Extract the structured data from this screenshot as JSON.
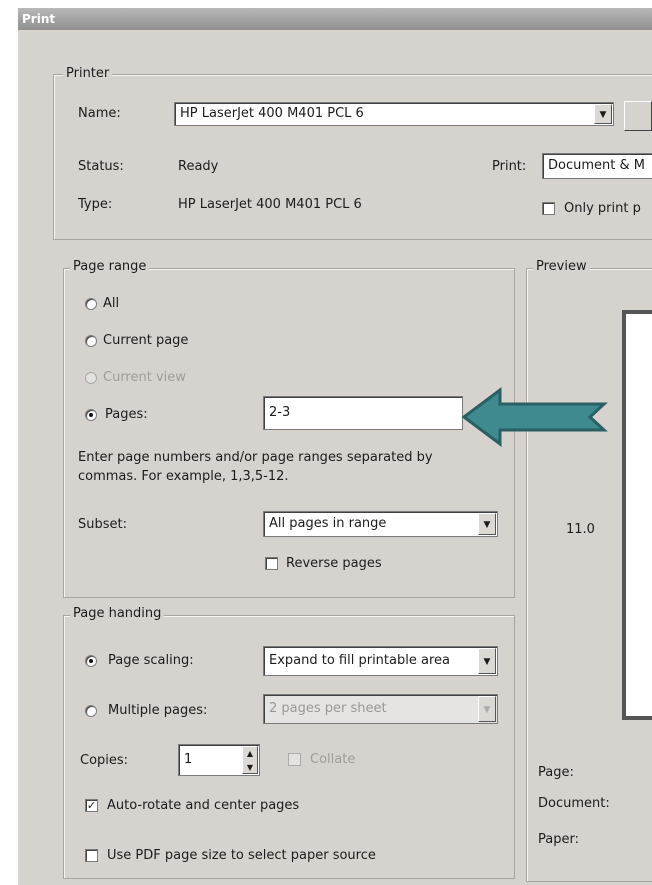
{
  "window": {
    "title": "Print"
  },
  "printer": {
    "group_label": "Printer",
    "name_label": "Name:",
    "name_value": "HP LaserJet 400 M401 PCL 6",
    "status_label": "Status:",
    "status_value": "Ready",
    "type_label": "Type:",
    "type_value": "HP LaserJet 400 M401 PCL 6",
    "print_label": "Print:",
    "print_value": "Document & M",
    "only_print_label": "Only print p"
  },
  "page_range": {
    "group_label": "Page range",
    "all_label": "All",
    "current_page_label": "Current page",
    "current_view_label": "Current view",
    "pages_label": "Pages:",
    "pages_value": "2-3",
    "hint_line1": "Enter page numbers and/or page ranges separated by",
    "hint_line2": "commas. For example, 1,3,5-12.",
    "subset_label": "Subset:",
    "subset_value": "All pages in range",
    "reverse_label": "Reverse pages"
  },
  "page_handling": {
    "group_label": "Page handing",
    "scaling_label": "Page scaling:",
    "scaling_value": "Expand to fill printable area",
    "multiple_label": "Multiple pages:",
    "multiple_value": "2 pages per sheet",
    "copies_label": "Copies:",
    "copies_value": "1",
    "collate_label": "Collate",
    "auto_rotate_label": "Auto-rotate and center pages",
    "pdf_size_label": "Use PDF page size to select paper source"
  },
  "preview": {
    "group_label": "Preview",
    "height_value": "11.0",
    "page_label": "Page:",
    "document_label": "Document:",
    "paper_label": "Paper:"
  },
  "colors": {
    "arrow": "#3e8a8f",
    "arrow_outline": "#2a5f63"
  }
}
